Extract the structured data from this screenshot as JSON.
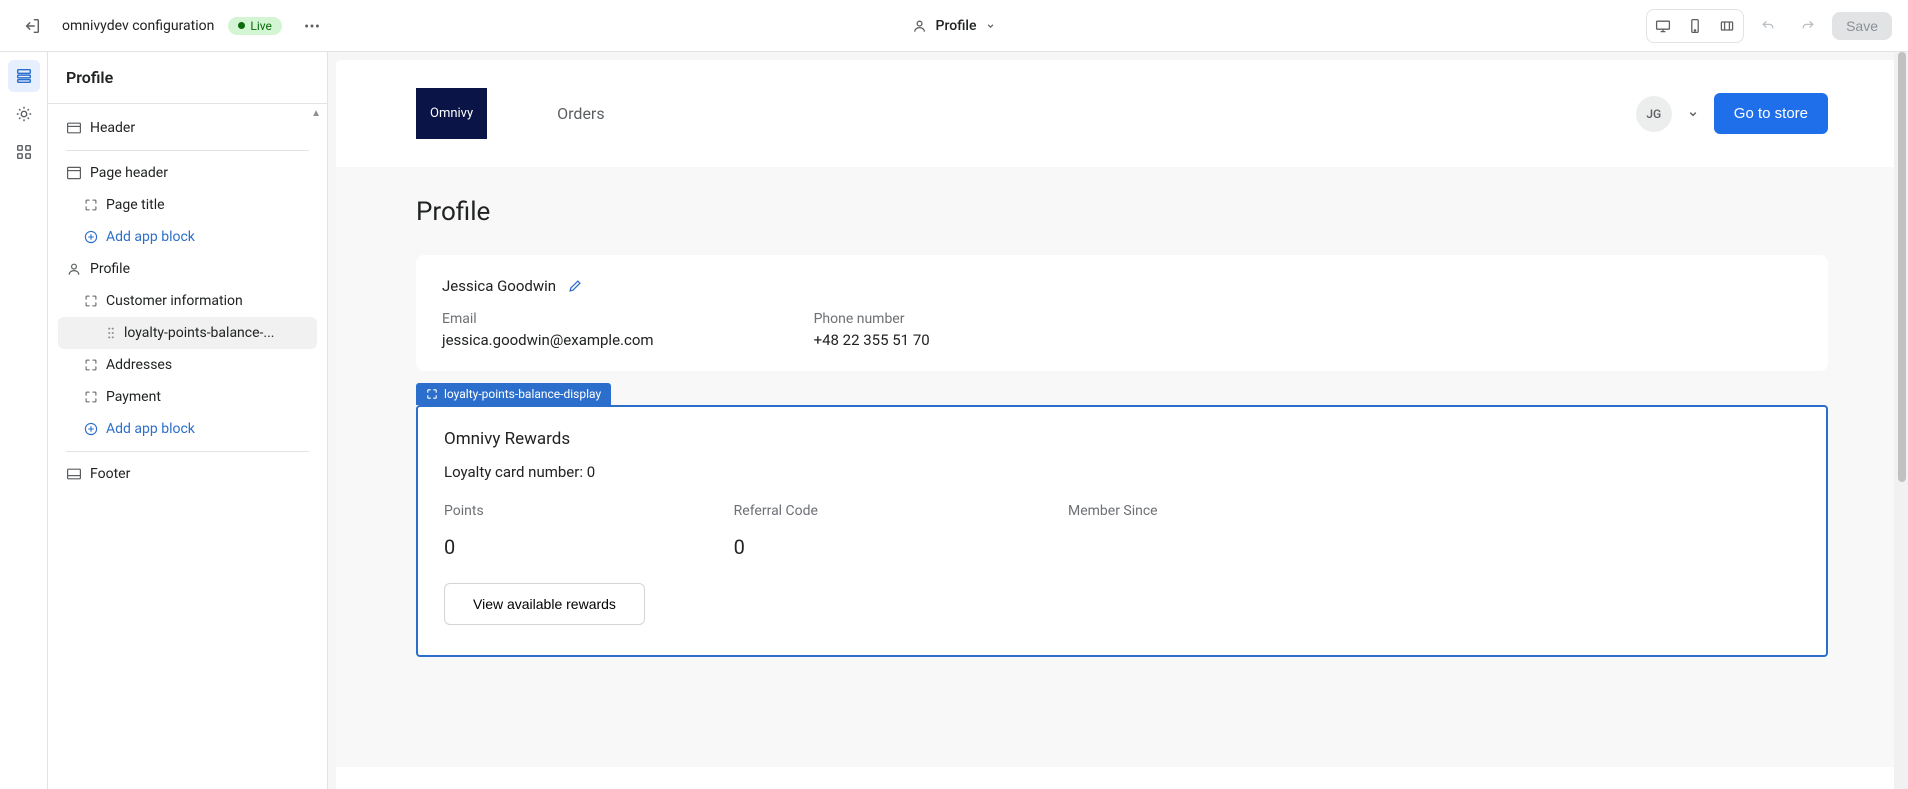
{
  "topbar": {
    "app_name": "omnivydev configuration",
    "live_label": "Live",
    "center_label": "Profile",
    "save_label": "Save"
  },
  "sidebar": {
    "title": "Profile",
    "header_label": "Header",
    "page_header_label": "Page header",
    "page_title_label": "Page title",
    "add_app_block_label": "Add app block",
    "profile_label": "Profile",
    "customer_info_label": "Customer information",
    "loyalty_block_label": "loyalty-points-balance-...",
    "addresses_label": "Addresses",
    "payment_label": "Payment",
    "footer_label": "Footer"
  },
  "store": {
    "logo_text": "Omnivy",
    "nav_orders": "Orders",
    "avatar_initials": "JG",
    "go_to_store": "Go to store"
  },
  "page": {
    "title": "Profile",
    "customer_name": "Jessica Goodwin",
    "email_label": "Email",
    "email_value": "jessica.goodwin@example.com",
    "phone_label": "Phone number",
    "phone_value": "+48 22 355 51 70",
    "block_tag": "loyalty-points-balance-display",
    "rewards_title": "Omnivy Rewards",
    "loyalty_card_text": "Loyalty card number: 0",
    "points_label": "Points",
    "points_value": "0",
    "referral_label": "Referral Code",
    "referral_value": "0",
    "member_since_label": "Member Since",
    "view_rewards_btn": "View available rewards"
  }
}
